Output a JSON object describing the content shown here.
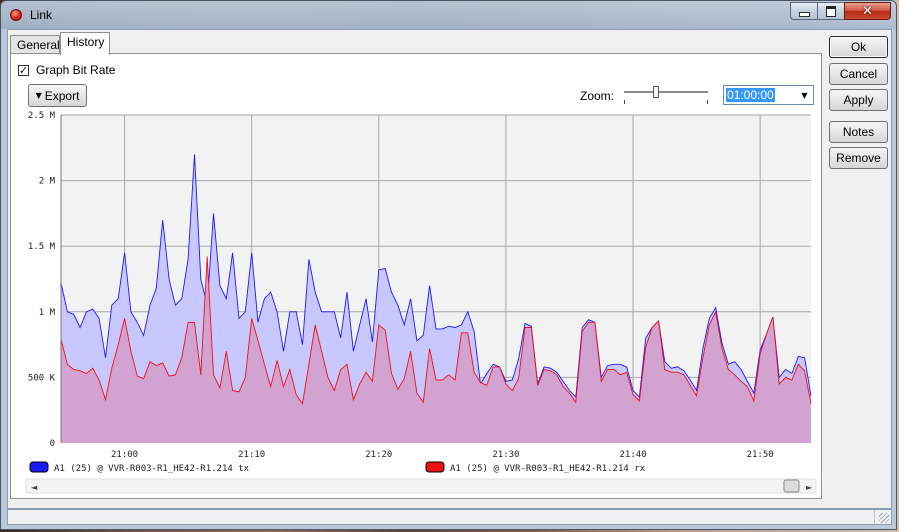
{
  "window": {
    "title": "Link"
  },
  "tabs": [
    {
      "label": "General"
    },
    {
      "label": "History"
    }
  ],
  "history": {
    "graph_bit_rate": {
      "label": "Graph Bit Rate",
      "checked": true,
      "check_glyph": "✓"
    },
    "export_label": "Export",
    "zoom_label": "Zoom:",
    "zoom_value": "01:00:00"
  },
  "buttons": {
    "ok": "Ok",
    "cancel": "Cancel",
    "apply": "Apply",
    "notes": "Notes",
    "remove": "Remove"
  },
  "colors": {
    "tx": "#1a1aff",
    "rx": "#ee1111",
    "tx_fill": "#c8c8ff",
    "rx_fill": "#d3a0cd"
  },
  "chart_data": {
    "type": "area",
    "ylim": [
      0,
      2500000
    ],
    "yticks": [
      {
        "value": 0,
        "label": "0"
      },
      {
        "value": 500000,
        "label": "500 K"
      },
      {
        "value": 1000000,
        "label": "1 M"
      },
      {
        "value": 1500000,
        "label": "1.5 M"
      },
      {
        "value": 2000000,
        "label": "2 M"
      },
      {
        "value": 2500000,
        "label": "2.5 M"
      }
    ],
    "xlim": [
      1255,
      1314
    ],
    "xticks": [
      {
        "value": 1260,
        "label": "21:00"
      },
      {
        "value": 1270,
        "label": "21:10"
      },
      {
        "value": 1280,
        "label": "21:20"
      },
      {
        "value": 1290,
        "label": "21:30"
      },
      {
        "value": 1300,
        "label": "21:40"
      },
      {
        "value": 1310,
        "label": "21:50"
      }
    ],
    "grid": true,
    "legend_placement": "bottom",
    "x": [
      1255,
      1255.5,
      1256,
      1256.5,
      1257,
      1257.5,
      1258,
      1258.5,
      1259,
      1259.5,
      1260,
      1260.5,
      1261,
      1261.5,
      1262,
      1262.5,
      1263,
      1263.5,
      1264,
      1264.5,
      1265,
      1265.5,
      1266,
      1266.5,
      1267,
      1267.5,
      1268,
      1268.5,
      1269,
      1269.5,
      1270,
      1270.5,
      1271,
      1271.5,
      1272,
      1272.5,
      1273,
      1273.5,
      1274,
      1274.5,
      1275,
      1275.5,
      1276,
      1276.5,
      1277,
      1277.5,
      1278,
      1278.5,
      1279,
      1279.5,
      1280,
      1280.5,
      1281,
      1281.5,
      1282,
      1282.5,
      1283,
      1283.5,
      1284,
      1284.5,
      1285,
      1285.5,
      1286,
      1286.5,
      1287,
      1287.5,
      1288,
      1288.5,
      1289,
      1289.5,
      1290,
      1290.5,
      1291,
      1291.5,
      1292,
      1292.5,
      1293,
      1293.5,
      1294,
      1294.5,
      1295,
      1295.5,
      1296,
      1296.5,
      1297,
      1297.5,
      1298,
      1298.5,
      1299,
      1299.5,
      1300,
      1300.5,
      1301,
      1301.5,
      1302,
      1302.5,
      1303,
      1303.5,
      1304,
      1304.5,
      1305,
      1305.5,
      1306,
      1306.5,
      1307,
      1307.5,
      1308,
      1308.5,
      1309,
      1309.5,
      1310,
      1310.5,
      1311,
      1311.5,
      1312,
      1312.5,
      1313,
      1313.5,
      1314
    ],
    "series": [
      {
        "name": "A1 (25) @ VVR-R003-R1_HE42-R1.214 tx",
        "values": [
          1220000,
          1000000,
          980000,
          880000,
          1000000,
          1020000,
          950000,
          650000,
          1050000,
          1100000,
          1450000,
          1000000,
          920000,
          820000,
          1050000,
          1180000,
          1700000,
          1250000,
          1050000,
          1100000,
          1400000,
          2200000,
          1250000,
          1050000,
          1750000,
          1200000,
          1100000,
          1450000,
          950000,
          1000000,
          1450000,
          920000,
          1100000,
          1150000,
          1000000,
          700000,
          1000000,
          1000000,
          750000,
          1400000,
          1150000,
          1000000,
          1000000,
          1000000,
          800000,
          1150000,
          700000,
          900000,
          1100000,
          770000,
          1320000,
          1330000,
          1150000,
          1050000,
          900000,
          1100000,
          780000,
          820000,
          1200000,
          870000,
          870000,
          890000,
          880000,
          900000,
          1000000,
          850000,
          450000,
          530000,
          600000,
          580000,
          470000,
          480000,
          640000,
          910000,
          890000,
          450000,
          580000,
          570000,
          540000,
          470000,
          400000,
          350000,
          880000,
          940000,
          920000,
          500000,
          590000,
          600000,
          600000,
          580000,
          400000,
          350000,
          800000,
          880000,
          930000,
          620000,
          570000,
          580000,
          550000,
          480000,
          400000,
          720000,
          950000,
          1030000,
          760000,
          600000,
          620000,
          560000,
          470000,
          380000,
          710000,
          830000,
          960000,
          500000,
          560000,
          530000,
          660000,
          650000,
          360000,
          620000
        ],
        "color": "#1a1aff"
      },
      {
        "name": "A1 (25) @ VVR-R003-R1_HE42-R1.214 rx",
        "values": [
          790000,
          600000,
          560000,
          550000,
          530000,
          570000,
          480000,
          330000,
          570000,
          750000,
          950000,
          700000,
          510000,
          490000,
          620000,
          590000,
          610000,
          510000,
          520000,
          650000,
          920000,
          920000,
          520000,
          1420000,
          520000,
          420000,
          700000,
          400000,
          390000,
          500000,
          950000,
          780000,
          600000,
          430000,
          630000,
          430000,
          560000,
          370000,
          300000,
          600000,
          900000,
          700000,
          500000,
          400000,
          560000,
          600000,
          330000,
          450000,
          540000,
          470000,
          900000,
          860000,
          530000,
          410000,
          490000,
          700000,
          380000,
          310000,
          720000,
          480000,
          480000,
          520000,
          480000,
          840000,
          840000,
          540000,
          460000,
          440000,
          580000,
          580000,
          450000,
          400000,
          490000,
          880000,
          880000,
          440000,
          560000,
          550000,
          520000,
          430000,
          380000,
          310000,
          850000,
          920000,
          920000,
          470000,
          560000,
          560000,
          520000,
          540000,
          370000,
          320000,
          730000,
          880000,
          930000,
          560000,
          540000,
          540000,
          520000,
          440000,
          360000,
          650000,
          900000,
          1000000,
          720000,
          560000,
          520000,
          470000,
          430000,
          320000,
          680000,
          830000,
          960000,
          450000,
          500000,
          480000,
          600000,
          550000,
          300000,
          560000
        ],
        "color": "#ee1111"
      }
    ]
  }
}
